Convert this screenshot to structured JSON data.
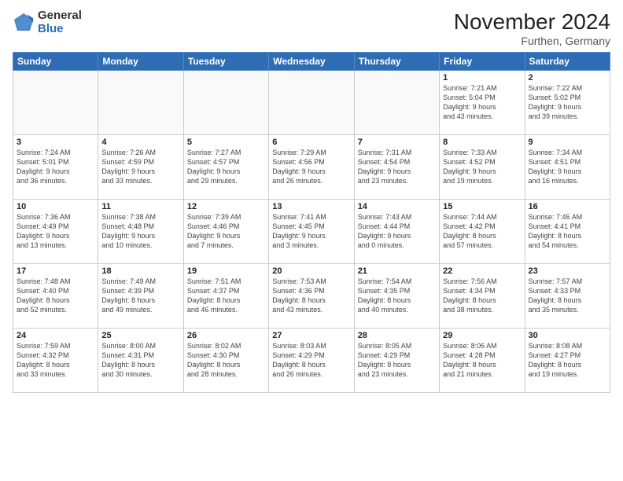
{
  "logo": {
    "general": "General",
    "blue": "Blue"
  },
  "header": {
    "month": "November 2024",
    "location": "Furthen, Germany"
  },
  "weekdays": [
    "Sunday",
    "Monday",
    "Tuesday",
    "Wednesday",
    "Thursday",
    "Friday",
    "Saturday"
  ],
  "weeks": [
    [
      {
        "day": "",
        "info": ""
      },
      {
        "day": "",
        "info": ""
      },
      {
        "day": "",
        "info": ""
      },
      {
        "day": "",
        "info": ""
      },
      {
        "day": "",
        "info": ""
      },
      {
        "day": "1",
        "info": "Sunrise: 7:21 AM\nSunset: 5:04 PM\nDaylight: 9 hours\nand 43 minutes."
      },
      {
        "day": "2",
        "info": "Sunrise: 7:22 AM\nSunset: 5:02 PM\nDaylight: 9 hours\nand 39 minutes."
      }
    ],
    [
      {
        "day": "3",
        "info": "Sunrise: 7:24 AM\nSunset: 5:01 PM\nDaylight: 9 hours\nand 36 minutes."
      },
      {
        "day": "4",
        "info": "Sunrise: 7:26 AM\nSunset: 4:59 PM\nDaylight: 9 hours\nand 33 minutes."
      },
      {
        "day": "5",
        "info": "Sunrise: 7:27 AM\nSunset: 4:57 PM\nDaylight: 9 hours\nand 29 minutes."
      },
      {
        "day": "6",
        "info": "Sunrise: 7:29 AM\nSunset: 4:56 PM\nDaylight: 9 hours\nand 26 minutes."
      },
      {
        "day": "7",
        "info": "Sunrise: 7:31 AM\nSunset: 4:54 PM\nDaylight: 9 hours\nand 23 minutes."
      },
      {
        "day": "8",
        "info": "Sunrise: 7:33 AM\nSunset: 4:52 PM\nDaylight: 9 hours\nand 19 minutes."
      },
      {
        "day": "9",
        "info": "Sunrise: 7:34 AM\nSunset: 4:51 PM\nDaylight: 9 hours\nand 16 minutes."
      }
    ],
    [
      {
        "day": "10",
        "info": "Sunrise: 7:36 AM\nSunset: 4:49 PM\nDaylight: 9 hours\nand 13 minutes."
      },
      {
        "day": "11",
        "info": "Sunrise: 7:38 AM\nSunset: 4:48 PM\nDaylight: 9 hours\nand 10 minutes."
      },
      {
        "day": "12",
        "info": "Sunrise: 7:39 AM\nSunset: 4:46 PM\nDaylight: 9 hours\nand 7 minutes."
      },
      {
        "day": "13",
        "info": "Sunrise: 7:41 AM\nSunset: 4:45 PM\nDaylight: 9 hours\nand 3 minutes."
      },
      {
        "day": "14",
        "info": "Sunrise: 7:43 AM\nSunset: 4:44 PM\nDaylight: 9 hours\nand 0 minutes."
      },
      {
        "day": "15",
        "info": "Sunrise: 7:44 AM\nSunset: 4:42 PM\nDaylight: 8 hours\nand 57 minutes."
      },
      {
        "day": "16",
        "info": "Sunrise: 7:46 AM\nSunset: 4:41 PM\nDaylight: 8 hours\nand 54 minutes."
      }
    ],
    [
      {
        "day": "17",
        "info": "Sunrise: 7:48 AM\nSunset: 4:40 PM\nDaylight: 8 hours\nand 52 minutes."
      },
      {
        "day": "18",
        "info": "Sunrise: 7:49 AM\nSunset: 4:39 PM\nDaylight: 8 hours\nand 49 minutes."
      },
      {
        "day": "19",
        "info": "Sunrise: 7:51 AM\nSunset: 4:37 PM\nDaylight: 8 hours\nand 46 minutes."
      },
      {
        "day": "20",
        "info": "Sunrise: 7:53 AM\nSunset: 4:36 PM\nDaylight: 8 hours\nand 43 minutes."
      },
      {
        "day": "21",
        "info": "Sunrise: 7:54 AM\nSunset: 4:35 PM\nDaylight: 8 hours\nand 40 minutes."
      },
      {
        "day": "22",
        "info": "Sunrise: 7:56 AM\nSunset: 4:34 PM\nDaylight: 8 hours\nand 38 minutes."
      },
      {
        "day": "23",
        "info": "Sunrise: 7:57 AM\nSunset: 4:33 PM\nDaylight: 8 hours\nand 35 minutes."
      }
    ],
    [
      {
        "day": "24",
        "info": "Sunrise: 7:59 AM\nSunset: 4:32 PM\nDaylight: 8 hours\nand 33 minutes."
      },
      {
        "day": "25",
        "info": "Sunrise: 8:00 AM\nSunset: 4:31 PM\nDaylight: 8 hours\nand 30 minutes."
      },
      {
        "day": "26",
        "info": "Sunrise: 8:02 AM\nSunset: 4:30 PM\nDaylight: 8 hours\nand 28 minutes."
      },
      {
        "day": "27",
        "info": "Sunrise: 8:03 AM\nSunset: 4:29 PM\nDaylight: 8 hours\nand 26 minutes."
      },
      {
        "day": "28",
        "info": "Sunrise: 8:05 AM\nSunset: 4:29 PM\nDaylight: 8 hours\nand 23 minutes."
      },
      {
        "day": "29",
        "info": "Sunrise: 8:06 AM\nSunset: 4:28 PM\nDaylight: 8 hours\nand 21 minutes."
      },
      {
        "day": "30",
        "info": "Sunrise: 8:08 AM\nSunset: 4:27 PM\nDaylight: 8 hours\nand 19 minutes."
      }
    ]
  ]
}
